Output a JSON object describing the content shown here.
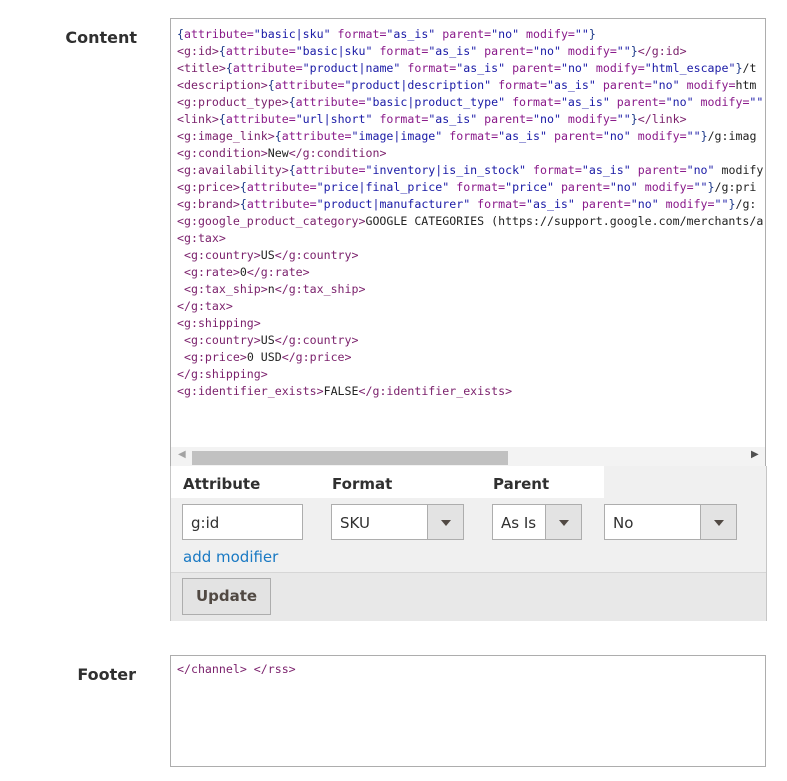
{
  "content": {
    "label": "Content",
    "lines": [
      "{attribute=\"basic|sku\" format=\"as_is\" parent=\"no\" modify=\"\"}",
      "<g:id>{attribute=\"basic|sku\" format=\"as_is\" parent=\"no\" modify=\"\"}</g:id>",
      "<title>{attribute=\"product|name\" format=\"as_is\" parent=\"no\" modify=\"html_escape\"}</t",
      "<description>{attribute=\"product|description\" format=\"as_is\" parent=\"no\" modify=\"htm",
      "<g:product_type>{attribute=\"basic|product_type\" format=\"as_is\" parent=\"no\" modify=\"\"",
      "<link>{attribute=\"url|short\" format=\"as_is\" parent=\"no\" modify=\"\"}</link>",
      "<g:image_link>{attribute=\"image|image\" format=\"as_is\" parent=\"no\" modify=\"\"}</g:imag",
      "<g:condition>New</g:condition>",
      "<g:availability>{attribute=\"inventory|is_in_stock\" format=\"as_is\" parent=\"no\" modify",
      "<g:price>{attribute=\"price|final_price\" format=\"price\" parent=\"no\" modify=\"\"}</g:pri",
      "<g:brand>{attribute=\"product|manufacturer\" format=\"as_is\" parent=\"no\" modify=\"\"}</g:",
      "<g:google_product_category>GOOGLE CATEGORIES (https://support.google.com/merchants/a",
      "<g:tax>",
      " <g:country>US</g:country>",
      " <g:rate>0</g:rate>",
      " <g:tax_ship>n</g:tax_ship>",
      "</g:tax>",
      "<g:shipping>",
      " <g:country>US</g:country>",
      " <g:price>0 USD</g:price>",
      "</g:shipping>",
      "<g:identifier_exists>FALSE</g:identifier_exists>"
    ]
  },
  "attribute_panel": {
    "headers": {
      "attribute": "Attribute",
      "format": "Format",
      "parent": "Parent"
    },
    "attribute_value": "g:id",
    "format_value": "SKU",
    "parent_value": "As Is",
    "modifier_value": "No",
    "add_modifier": "add modifier",
    "update_label": "Update"
  },
  "footer": {
    "label": "Footer",
    "text": "</channel> </rss>"
  },
  "colors": {
    "tag": "#7a1f6b",
    "attr_key": "#8a1a8a",
    "attr_string": "#1a1aa6",
    "brace": "#1e3a8a",
    "link": "#1979c3"
  }
}
